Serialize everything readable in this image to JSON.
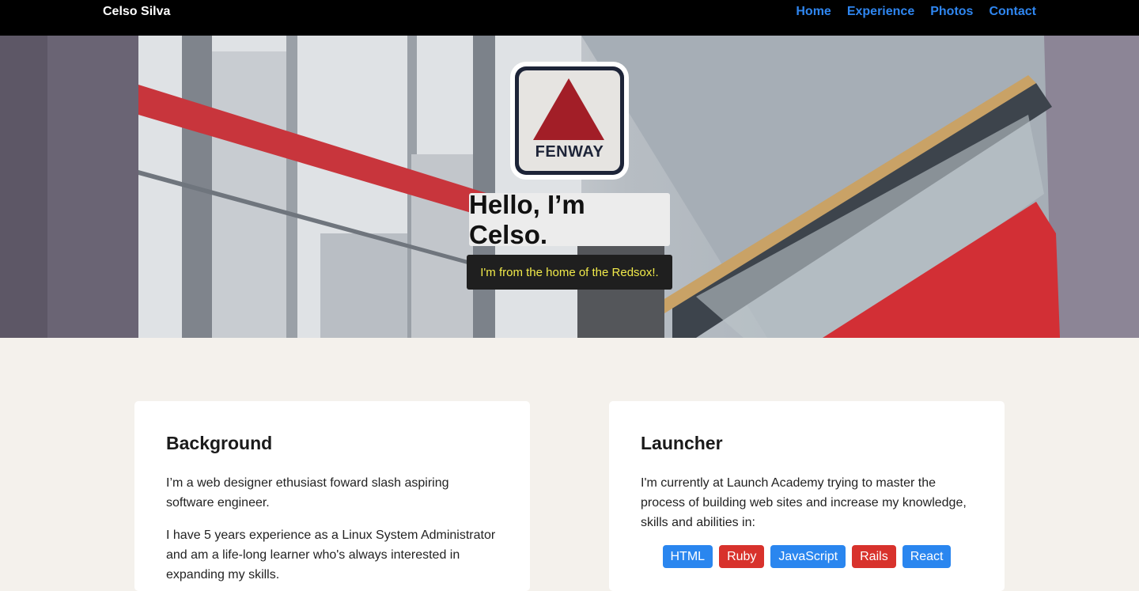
{
  "nav": {
    "brand": "Celso Silva",
    "links": [
      "Home",
      "Experience",
      "Photos",
      "Contact"
    ],
    "link_color": "#2f86f0"
  },
  "hero": {
    "logo_text": "FENWAY",
    "title": "Hello, I’m Celso.",
    "subtitle": "I'm from the home of the Redsox!.",
    "subtitle_color": "#f1ea4a"
  },
  "cards": [
    {
      "title": "Background",
      "paragraphs": [
        "I’m a web designer ethusiast foward slash aspiring software engineer.",
        "I have 5 years experience as a Linux System Administrator and am a life-long learner who's always interested in expanding my skills."
      ]
    },
    {
      "title": "Launcher",
      "paragraphs": [
        "I'm currently at Launch Academy trying to master the process of building web sites and increase my knowledge, skills and abilities in:"
      ],
      "tags": [
        {
          "label": "HTML",
          "color": "#2a86ef"
        },
        {
          "label": "Ruby",
          "color": "#d8322c"
        },
        {
          "label": "JavaScript",
          "color": "#2a86ef"
        },
        {
          "label": "Rails",
          "color": "#d8322c"
        },
        {
          "label": "React",
          "color": "#2a86ef"
        }
      ]
    }
  ]
}
